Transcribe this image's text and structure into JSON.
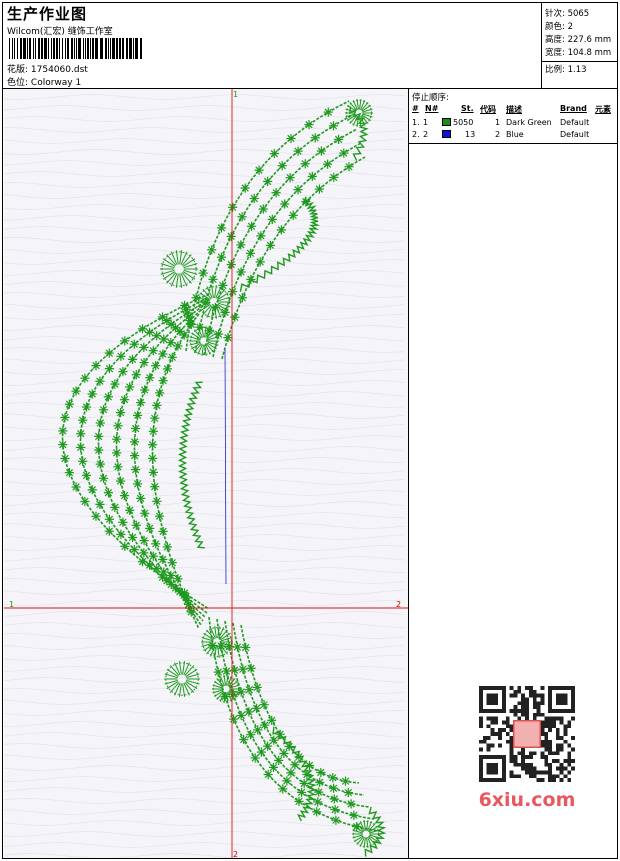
{
  "header": {
    "title": "生产作业图",
    "studio": "Wilcom(汇宏) 缝饰工作室",
    "file_label": "花版:",
    "file_name": "1754060.dst",
    "colorway_label": "色位:",
    "colorway_name": "Colorway 1"
  },
  "stats": {
    "stitches_label": "针次:",
    "stitches": "5065",
    "colors_label": "颜色:",
    "colors": "2",
    "height_label": "高度:",
    "height": "227.6 mm",
    "width_label": "宽度:",
    "width": "104.8 mm",
    "scale_label": "比例:",
    "scale": "1.13"
  },
  "stop_sequence": {
    "title": "停止顺序:",
    "columns": [
      "#",
      "N#",
      "St.",
      "代码",
      "描述",
      "Brand",
      "元素"
    ],
    "rows": [
      {
        "index": "1.",
        "needle": "1",
        "stitches": "5050",
        "code": "1",
        "description": "Dark Green",
        "brand": "Default",
        "color": "#1a8c1a"
      },
      {
        "index": "2.",
        "needle": "2",
        "stitches": "13",
        "code": "2",
        "description": "Blue",
        "brand": "Default",
        "color": "#1010dd"
      }
    ]
  },
  "axes": {
    "top_label": "1",
    "left_label": "1",
    "right_label": "2",
    "bottom_label": "2"
  },
  "watermark": {
    "brand": "6xiu.com"
  },
  "colors": {
    "stitch_green": "#1f9a1f",
    "guide_red": "#e01010",
    "jump_blue": "#2222cc"
  }
}
